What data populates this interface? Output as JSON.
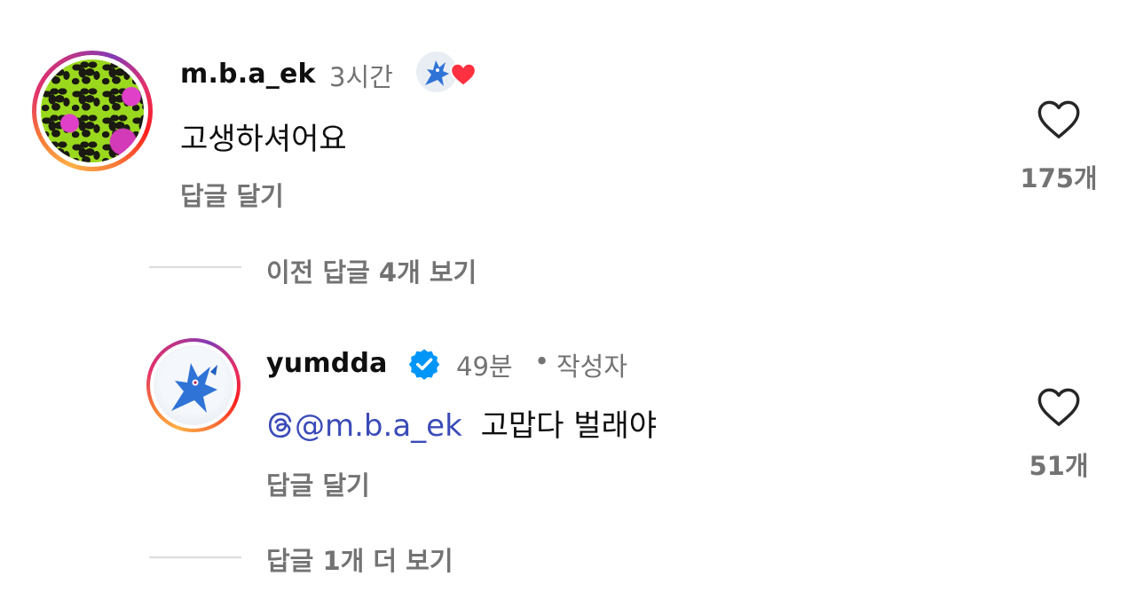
{
  "comment1": {
    "username": "m.b.a_ek",
    "time": "3시간",
    "text": "고생하셔어요",
    "reply_label": "답글 달기",
    "like_count": "175개",
    "liked_by_author": true
  },
  "thread1": {
    "view_more_label": "이전 답글 4개 보기"
  },
  "comment2": {
    "username": "yumdda",
    "verified": true,
    "time": "49분",
    "separator": "•",
    "author_label": "작성자",
    "mention": "@m.b.a_ek",
    "text": "고맙다 벌래야",
    "reply_label": "답글 달기",
    "like_count": "51개"
  },
  "thread2": {
    "view_more_label": "답글 1개 더 보기"
  },
  "icons": {
    "heart": "heart-outline-icon",
    "verified": "verified-badge-icon",
    "threads": "threads-icon",
    "liked": "creator-liked-heart-icon"
  },
  "colors": {
    "mention": "#3b4bb8",
    "verified": "#0095f6",
    "liked_heart": "#ff3040",
    "muted_text": "#737373"
  }
}
